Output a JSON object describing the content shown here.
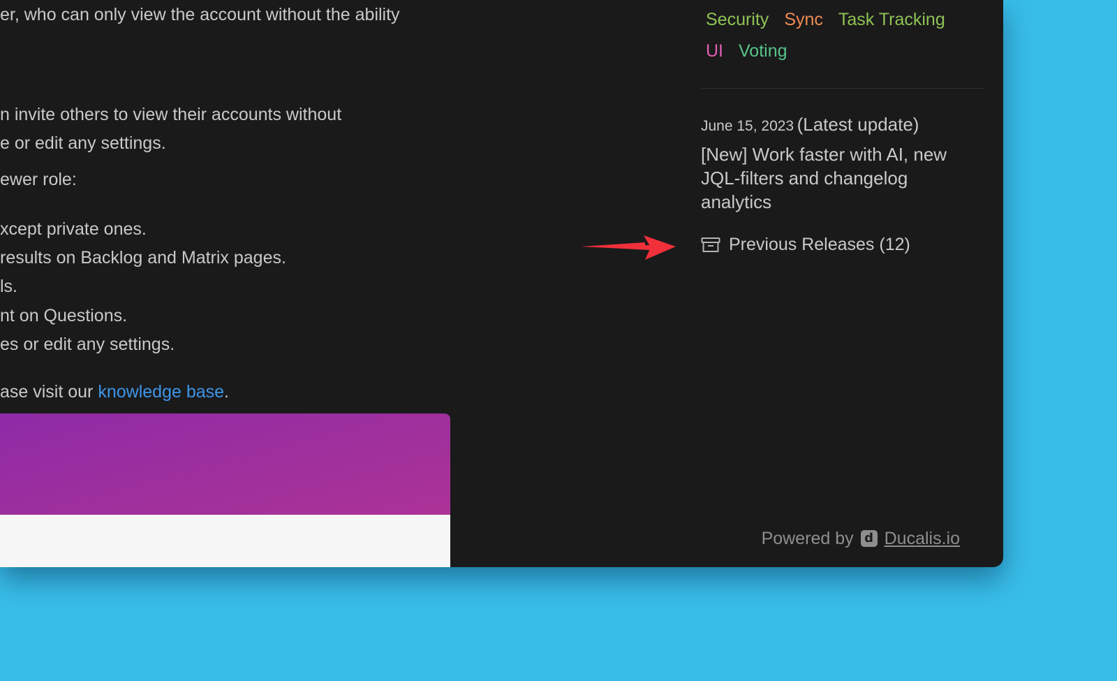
{
  "article": {
    "line1": "er, who can only view the account without the ability",
    "line2": "n invite others to view their accounts without",
    "line3": "e or edit any settings.",
    "line4": "ewer role:",
    "line5": "xcept private ones.",
    "line6": "results on Backlog and Matrix pages.",
    "line7": "ls.",
    "line8": "nt on Questions.",
    "line9": "es or edit any settings.",
    "line10_prefix": "ase visit our ",
    "kb_link": "knowledge base",
    "line10_suffix": "."
  },
  "sidebar": {
    "tags": [
      {
        "label": "Security",
        "color": "#8fc353"
      },
      {
        "label": "Sync",
        "color": "#ef8b51"
      },
      {
        "label": "Task Tracking",
        "color": "#8fc353"
      },
      {
        "label": "UI",
        "color": "#e25fb3"
      },
      {
        "label": "Voting",
        "color": "#56c48a"
      }
    ],
    "update_date": "June 15, 2023",
    "update_latest": "(Latest update)",
    "update_title": "[New] Work faster with AI, new JQL-filters and changelog analytics",
    "previous_releases": "Previous Releases (12)"
  },
  "footer": {
    "powered_by": "Powered by",
    "logo_letter": "d",
    "brand": "Ducalis.io"
  },
  "colors": {
    "page_background": "#38bde9",
    "window_background": "#1a1a1b",
    "link": "#3d95e6",
    "arrow": "#f0303a",
    "banner_purple": "#9c2f9e"
  },
  "icons": {
    "previous_releases": "archive-box-icon",
    "annotation": "red-arrow-icon"
  }
}
